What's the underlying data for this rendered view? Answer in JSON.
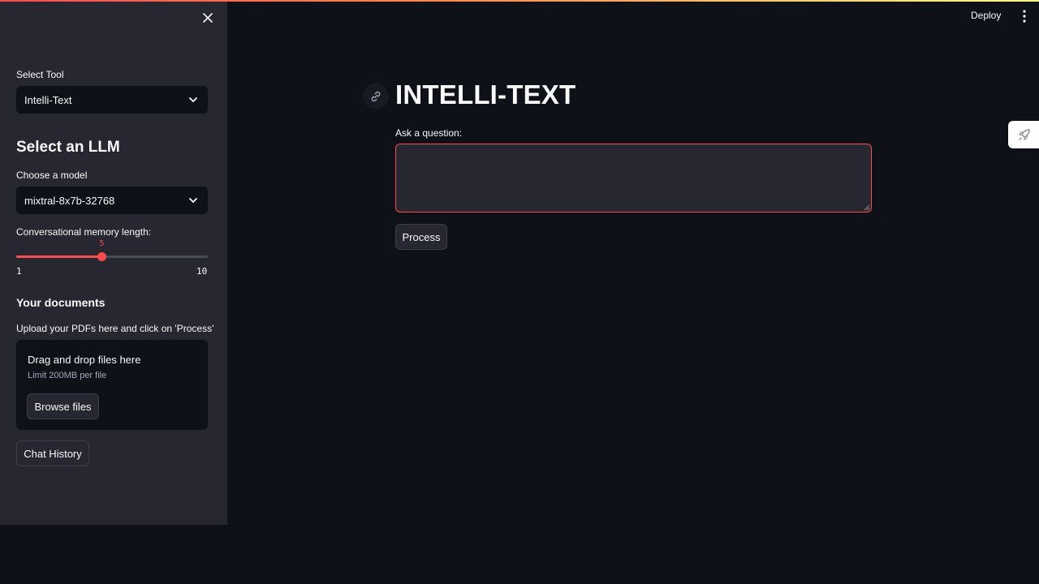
{
  "colors": {
    "background": "#0e1117",
    "sidebar": "#262730",
    "accent": "#ff4b4b",
    "text": "#fafafa",
    "muted_text": "#a3a8b8"
  },
  "header": {
    "deploy_label": "Deploy",
    "menu_icon": "kebab-menu-icon"
  },
  "sidebar": {
    "close_icon": "close-icon",
    "tool_select": {
      "label": "Select Tool",
      "value": "Intelli-Text"
    },
    "llm_heading": "Select an LLM",
    "model_select": {
      "label": "Choose a model",
      "value": "mixtral-8x7b-32768"
    },
    "memory_slider": {
      "label": "Conversational memory length:",
      "value": 5,
      "value_text": "5",
      "min": 1,
      "max": 10,
      "min_text": "1",
      "max_text": "10"
    },
    "documents": {
      "heading": "Your documents",
      "instruction": "Upload your PDFs here and click on 'Process'",
      "dropzone_title": "Drag and drop files here",
      "dropzone_limit": "Limit 200MB per file",
      "browse_label": "Browse files"
    },
    "chat_history_label": "Chat History"
  },
  "main": {
    "title": "INTELLI-TEXT",
    "question_label": "Ask a question:",
    "question_value": "",
    "process_label": "Process"
  },
  "floating": {
    "rocket_icon": "rocket-icon"
  }
}
